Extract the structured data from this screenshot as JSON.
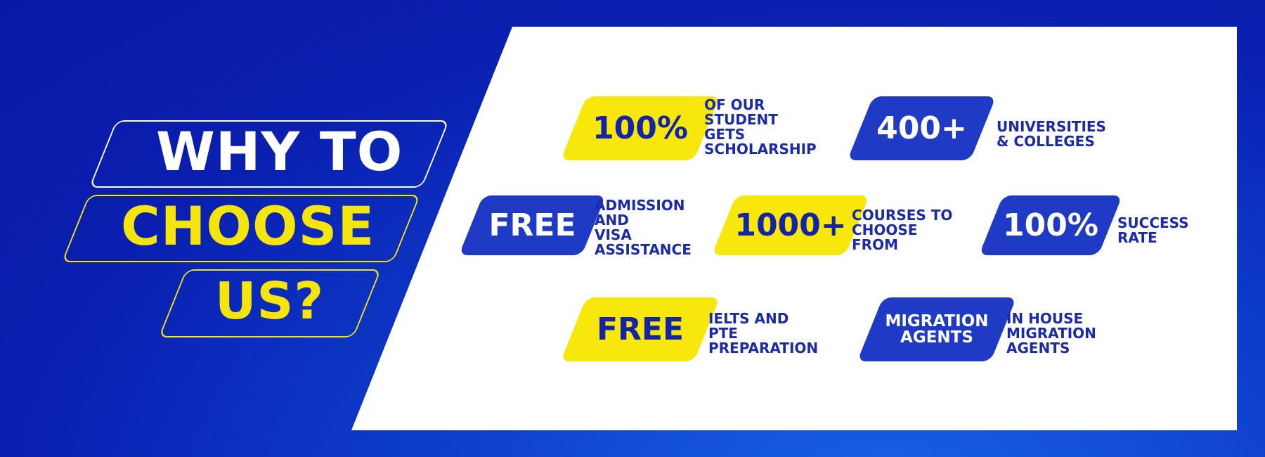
{
  "heading": {
    "line1": "WHY TO",
    "line2": "CHOOSE",
    "line3": "US?"
  },
  "features": [
    {
      "badge": "100%",
      "description": "OF OUR\nSTUDENT\nGETS\nSCHOLARSHIP",
      "badge_color": "#f7e70a"
    },
    {
      "badge": "400+",
      "description": "UNIVERSITIES\n& COLLEGES",
      "badge_color": "#1f3bc6"
    },
    {
      "badge": "FREE",
      "description": "ADMISSION\nAND\nVISA\nASSISTANCE",
      "badge_color": "#1f3bc6"
    },
    {
      "badge": "1000+",
      "description": "COURSES TO\nCHOOSE\nFROM",
      "badge_color": "#f7e70a"
    },
    {
      "badge": "100%",
      "description": "SUCCESS\nRATE",
      "badge_color": "#1f3bc6"
    },
    {
      "badge": "FREE",
      "description": "IELTS AND\nPTE\nPREPARATION",
      "badge_color": "#f7e70a"
    },
    {
      "badge": "MIGRATION\nAGENTS",
      "description": "IN HOUSE\nMIGRATION\nAGENTS",
      "badge_color": "#1f3bc6"
    }
  ],
  "colors": {
    "background_blue": "#0a1fb0",
    "accent_yellow": "#f5e50c",
    "text_blue": "#1a2aa8",
    "white": "#ffffff"
  }
}
